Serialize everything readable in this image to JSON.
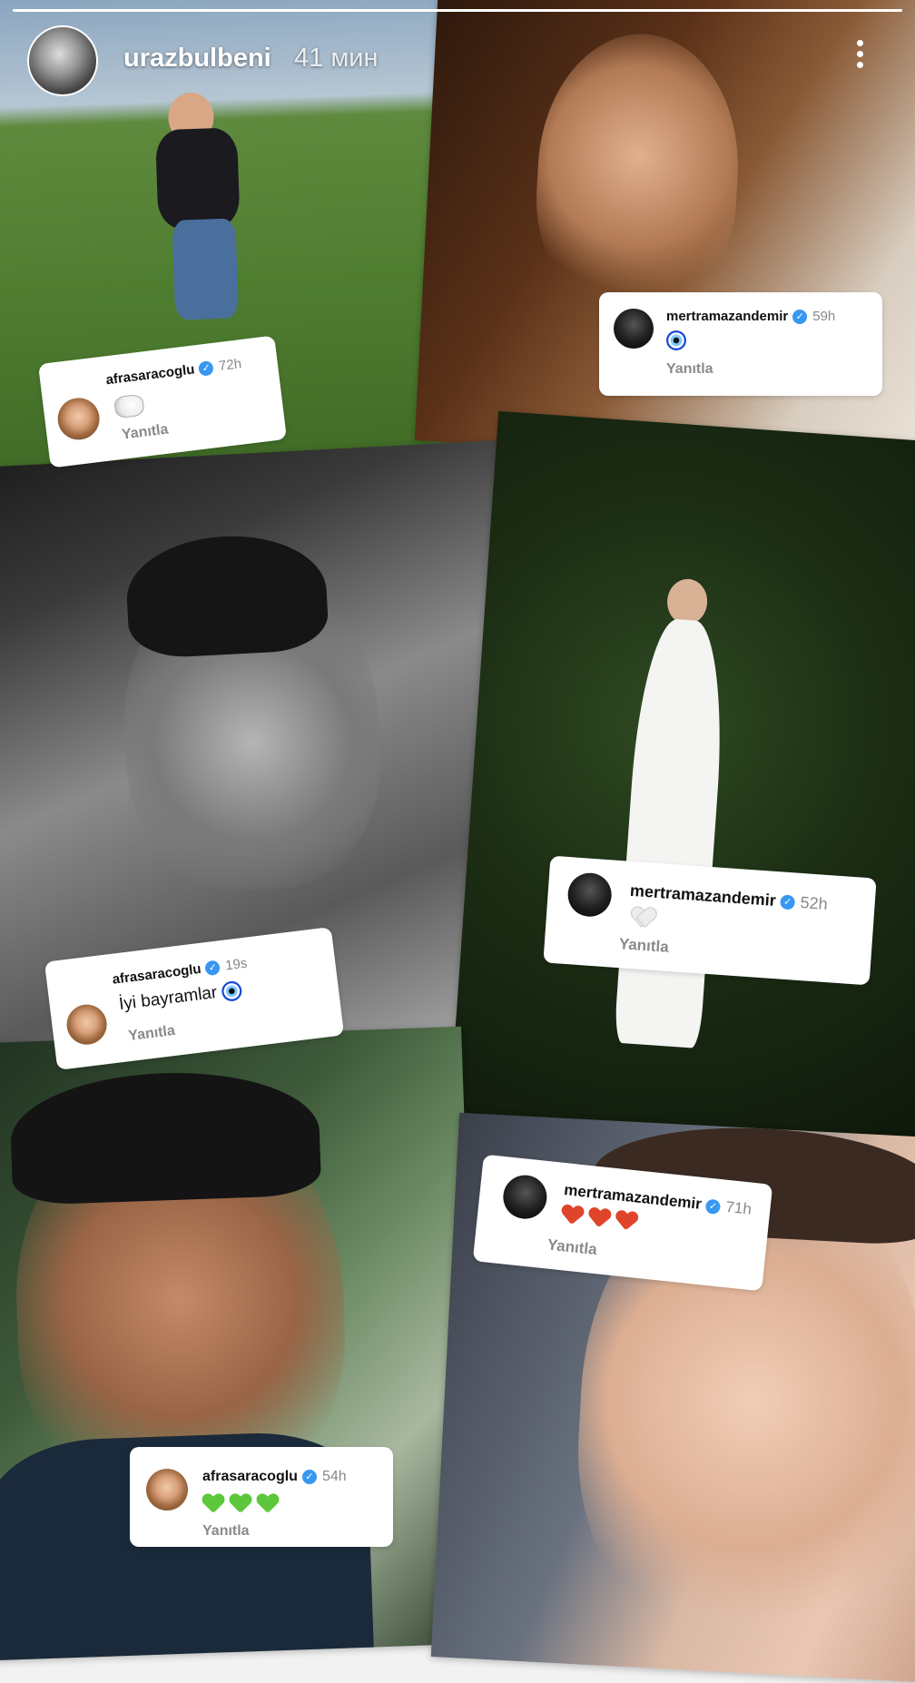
{
  "story": {
    "username": "urazbulbeni",
    "time": "41 мин",
    "progress": 1.0
  },
  "comments": [
    {
      "user": "afrasaracoglu",
      "time": "72h",
      "message": "",
      "emoji": "sheep",
      "reply": "Yanıtla"
    },
    {
      "user": "mertramazandemir",
      "time": "59h",
      "message": "",
      "emoji": "evil-eye",
      "reply": "Yanıtla"
    },
    {
      "user": "afrasaracoglu",
      "time": "19s",
      "message": "İyi bayramlar",
      "emoji": "evil-eye",
      "reply": "Yanıtla"
    },
    {
      "user": "mertramazandemir",
      "time": "52h",
      "message": "",
      "emoji": "white-heart",
      "reply": "Yanıtla"
    },
    {
      "user": "mertramazandemir",
      "time": "71h",
      "message": "",
      "emoji": "heart-on-fire x3",
      "reply": "Yanıtla"
    },
    {
      "user": "afrasaracoglu",
      "time": "54h",
      "message": "",
      "emoji": "green-heart x3",
      "reply": "Yanıtla"
    }
  ],
  "colors": {
    "verified": "#3897f0",
    "reply": "#8a8a8a",
    "card": "#ffffff"
  }
}
